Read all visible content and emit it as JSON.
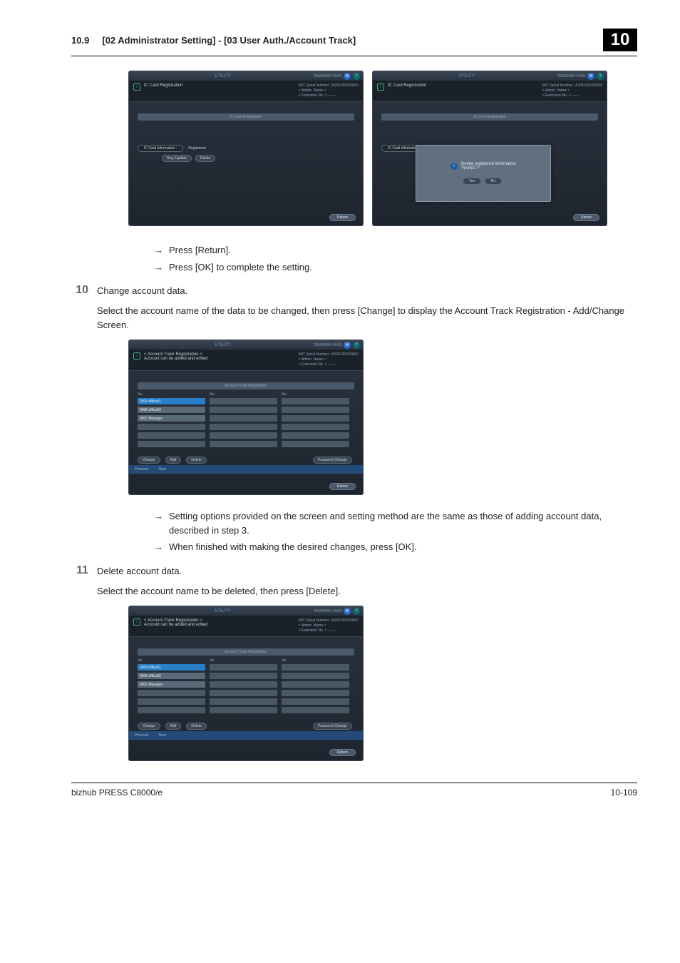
{
  "header": {
    "section": "10.9",
    "title": "[02 Administrator Setting] - [03 User Auth./Account Track]",
    "chapter": "10"
  },
  "timestamp": "2010/04/04  14:00",
  "utility_label": "UTILITY",
  "ic_card": {
    "title": "IC Card Registration",
    "meta_serial": "M/C Serial Number : A1RF001000000",
    "meta_admin": "< Admin. Name >",
    "meta_ext": "< Extension No. > ------",
    "panel_head": "IC Card Registration",
    "info_label": "IC Card Information :",
    "status": "Registered",
    "btn_reg": "Reg./Update",
    "btn_del": "Delete",
    "return": "Return"
  },
  "modal": {
    "msg": "Delete registered information",
    "msg2": "Yes/NO ?",
    "yes": "Yes",
    "no": "No"
  },
  "instr_a": [
    "Press [Return].",
    "Press [OK] to complete the setting."
  ],
  "step10": {
    "num": "10",
    "head": "Change account data.",
    "body": "Select the account name of the data to be changed, then press [Change] to display the Account Track Registration - Add/Change Screen."
  },
  "account_track": {
    "title_l1": "< Account Track Registration >",
    "title_l2": "Account can be added and edited",
    "panel_head": "Account Track Registration",
    "col_label": "No.",
    "items": [
      "0004 office01",
      "0005 office02",
      "0007 Manager"
    ],
    "btn_change": "Change",
    "btn_add": "Add",
    "btn_delete": "Delete",
    "btn_pw": "Password Change",
    "prev": "Previous",
    "next": "Next",
    "return": "Return"
  },
  "instr_b": [
    "Setting options provided on the screen and setting method are the same as those of adding account data, described in step 3.",
    "When finished with making the desired changes, press [OK]."
  ],
  "step11": {
    "num": "11",
    "head": "Delete account data.",
    "body": "Select the account name to be deleted, then press [Delete]."
  },
  "footer": {
    "product": "bizhub PRESS C8000/e",
    "page": "10-109"
  }
}
